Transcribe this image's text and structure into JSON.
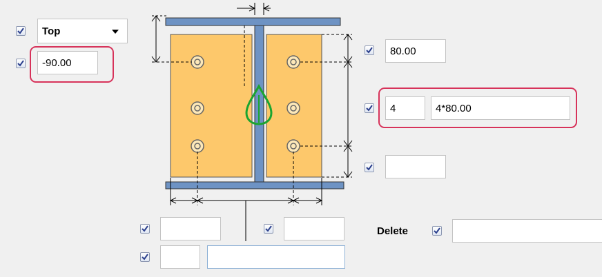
{
  "position_combo": {
    "selected": "Top"
  },
  "offset_field": {
    "value": "-90.00"
  },
  "right_top_field": {
    "value": "80.00"
  },
  "bolt_count_field": {
    "value": "4"
  },
  "bolt_spacing_field": {
    "value": "4*80.00"
  },
  "right_bottom_field": {
    "value": ""
  },
  "bottom_left_field": {
    "value": ""
  },
  "bottom_right_field": {
    "value": ""
  },
  "bottom_small_field": {
    "value": ""
  },
  "bottom_wide_field": {
    "value": ""
  },
  "delete_section": {
    "label": "Delete",
    "value": ""
  },
  "colors": {
    "plate_fill": "#fdc86b",
    "beam_fill": "#6e93c4",
    "highlight": "#d7325a",
    "symbol_green": "#1aa530"
  },
  "icons": [
    "checkbox-checked-icon",
    "dropdown-arrow-icon",
    "bolt-icon",
    "web-symbol-icon"
  ]
}
